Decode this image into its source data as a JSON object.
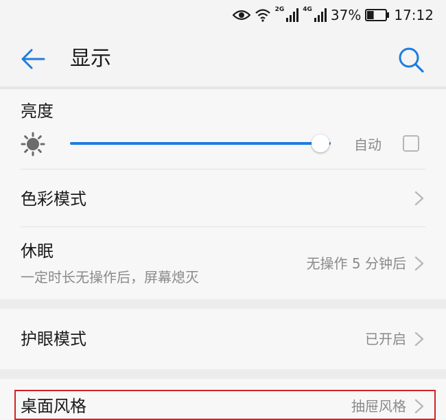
{
  "status": {
    "network_2g": "2G",
    "network_4g": "4G",
    "battery_percent": "37%",
    "battery_level": 0.37,
    "time": "17:12",
    "icons": [
      "eye-comfort-icon",
      "wifi-icon",
      "signal-icon",
      "signal-icon",
      "battery-icon"
    ]
  },
  "app_bar": {
    "title": "显示",
    "back_icon": "back-arrow-icon",
    "search_icon": "search-icon"
  },
  "brightness": {
    "label": "亮度",
    "icon": "brightness-sun-icon",
    "level": 0.96,
    "auto_label": "自动",
    "auto_checked": false
  },
  "items": {
    "color_mode": {
      "title": "色彩模式"
    },
    "sleep": {
      "title": "休眠",
      "subtitle": "一定时长无操作后，屏幕熄灭",
      "value": "无操作 5 分钟后"
    },
    "eye_comfort": {
      "title": "护眼模式",
      "value": "已开启"
    },
    "home_style": {
      "title": "桌面风格",
      "value": "抽屉风格"
    }
  },
  "colors": {
    "accent": "#1e7ce0",
    "highlight": "#d32222"
  }
}
